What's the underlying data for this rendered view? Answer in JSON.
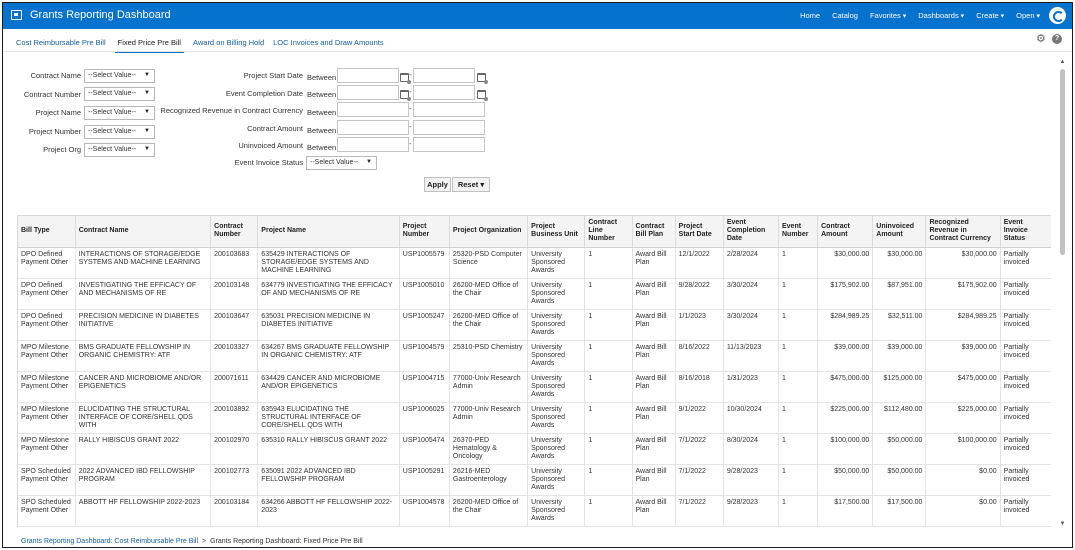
{
  "header": {
    "title": "Grants Reporting Dashboard",
    "nav": [
      "Home",
      "Catalog",
      "Favorites",
      "Dashboards",
      "Create",
      "Open"
    ],
    "accent_color": "#0572ce"
  },
  "tabs": [
    "Cost Reimbursable Pre Bill",
    "Fixed Price Pre Bill",
    "Award on Billing Hold",
    "LOC Invoices and Draw Amounts"
  ],
  "active_tab": "Fixed Price Pre Bill",
  "filters": {
    "contract_name": {
      "label": "Contract Name",
      "value": "--Select Value--"
    },
    "contract_number": {
      "label": "Contract Number",
      "value": "--Select Value--"
    },
    "project_name": {
      "label": "Project Name",
      "value": "--Select Value--"
    },
    "project_number": {
      "label": "Project Number",
      "value": "--Select Value--"
    },
    "project_org": {
      "label": "Project Org",
      "value": "--Select Value--"
    },
    "project_start_date": {
      "label": "Project Start Date",
      "op": "Between"
    },
    "event_completion_date": {
      "label": "Event Completion Date",
      "op": "Between"
    },
    "recognized_revenue": {
      "label": "Recognized Revenue in Contract Currency",
      "op": "Between"
    },
    "contract_amount": {
      "label": "Contract Amount",
      "op": "Between"
    },
    "uninvoiced_amount": {
      "label": "Uninvoiced Amount",
      "op": "Between"
    },
    "event_invoice_status": {
      "label": "Event Invoice Status",
      "value": "--Select Value--"
    },
    "range_separator": "-",
    "apply_label": "Apply",
    "reset_label": "Reset"
  },
  "table": {
    "columns": [
      "Bill Type",
      "Contract Name",
      "Contract Number",
      "Project Name",
      "Project Number",
      "Project Organization",
      "Project Business Unit",
      "Contract Line Number",
      "Contract Bill Plan",
      "Project Start Date",
      "Event Completion Date",
      "Event Number",
      "Contract Amount",
      "Uninvoiced Amount",
      "Recognized Revenue in Contract Currency",
      "Event Invoice Status"
    ],
    "rows": [
      [
        "DPO Defined Payment Other",
        "INTERACTIONS OF STORAGE/EDGE SYSTEMS AND MACHINE LEARNING",
        "200103683",
        "635429 INTERACTIONS OF STORAGE/EDGE SYSTEMS AND MACHINE LEARNING",
        "USP1005579",
        "25320-PSD Computer Science",
        "University Sponsored Awards",
        "1",
        "Award Bill Plan",
        "12/1/2022",
        "2/28/2024",
        "1",
        "$30,000.00",
        "$30,000.00",
        "$30,000.00",
        "Partially invoiced"
      ],
      [
        "DPO Defined Payment Other",
        "INVESTIGATING THE EFFICACY OF AND MECHANISMS OF RE",
        "200103148",
        "634779 INVESTIGATING THE EFFICACY OF AND MECHANISMS OF RE",
        "USP1005010",
        "26200-MED Office of the Chair",
        "University Sponsored Awards",
        "1",
        "Award Bill Plan",
        "9/28/2022",
        "3/30/2024",
        "1",
        "$175,902.00",
        "$87,951.00",
        "$175,902.00",
        "Partially invoiced"
      ],
      [
        "DPO Defined Payment Other",
        "PRECISION MEDICINE IN DIABETES INITIATIVE",
        "200103647",
        "635031 PRECISION MEDICINE IN DIABETES INITIATIVE",
        "USP1005247",
        "26200-MED Office of the Chair",
        "University Sponsored Awards",
        "1",
        "Award Bill Plan",
        "1/1/2023",
        "3/30/2024",
        "1",
        "$284,989.25",
        "$32,511.00",
        "$284,989.25",
        "Partially invoiced"
      ],
      [
        "MPO Milestone Payment Other",
        "BMS GRADUATE FELLOWSHIP IN ORGANIC CHEMISTRY: ATF",
        "200103327",
        "634267 BMS GRADUATE FELLOWSHIP IN ORGANIC CHEMISTRY: ATF",
        "USP1004579",
        "25310-PSD Chemistry",
        "University Sponsored Awards",
        "1",
        "Award Bill Plan",
        "8/16/2022",
        "11/13/2023",
        "1",
        "$39,000.00",
        "$39,000.00",
        "$39,000.00",
        "Partially invoiced"
      ],
      [
        "MPO Milestone Payment Other",
        "CANCER AND MICROBIOME AND/OR EPIGENETICS",
        "200071611",
        "634429 CANCER AND MICROBIOME AND/OR EPIGENETICS",
        "USP1004715",
        "77000-Univ Research Admin",
        "University Sponsored Awards",
        "1",
        "Award Bill Plan",
        "8/16/2018",
        "1/31/2023",
        "1",
        "$475,000.00",
        "$125,000.00",
        "$475,000.00",
        "Partially invoiced"
      ],
      [
        "MPO Milestone Payment Other",
        "ELUCIDATING THE STRUCTURAL INTERFACE OF CORE/SHELL QDS WITH",
        "200103892",
        "635943 ELUCIDATING THE STRUCTURAL INTERFACE OF CORE/SHELL QDS WITH",
        "USP1006025",
        "77000-Univ Research Admin",
        "University Sponsored Awards",
        "1",
        "Award Bill Plan",
        "9/1/2022",
        "10/30/2024",
        "1",
        "$225,000.00",
        "$112,480.00",
        "$225,000.00",
        "Partially invoiced"
      ],
      [
        "MPO Milestone Payment Other",
        "RALLY HIBISCUS GRANT 2022",
        "200102970",
        "635310 RALLY HIBISCUS GRANT 2022",
        "USP1005474",
        "26370-PED Hematology & Oncology",
        "University Sponsored Awards",
        "1",
        "Award Bill Plan",
        "7/1/2022",
        "8/30/2024",
        "1",
        "$100,000.00",
        "$50,000.00",
        "$100,000.00",
        "Partially invoiced"
      ],
      [
        "SPO Scheduled Payment Other",
        "2022 ADVANCED IBD FELLOWSHIP PROGRAM",
        "200102773",
        "635091 2022 ADVANCED IBD FELLOWSHIP PROGRAM",
        "USP1005291",
        "26216-MED Gastroenterology",
        "University Sponsored Awards",
        "1",
        "Award Bill Plan",
        "7/1/2022",
        "9/28/2023",
        "1",
        "$50,000.00",
        "$50,000.00",
        "$0.00",
        "Partially invoiced"
      ],
      [
        "SPO Scheduled Payment Other",
        "ABBOTT HF FELLOWSHIP 2022-2023",
        "200103184",
        "634266 ABBOTT HF FELLOWSHIP 2022-2023",
        "USP1004578",
        "26200-MED Office of the Chair",
        "University Sponsored Awards",
        "1",
        "Award Bill Plan",
        "7/1/2022",
        "9/28/2023",
        "1",
        "$17,500.00",
        "$17,500.00",
        "$0.00",
        "Partially invoiced"
      ]
    ]
  },
  "breadcrumb": {
    "link": "Grants Reporting Dashboard: Cost Reimbursable Pre Bill",
    "separator": ">",
    "current": "Grants Reporting Dashboard: Fixed Price Pre Bill"
  }
}
